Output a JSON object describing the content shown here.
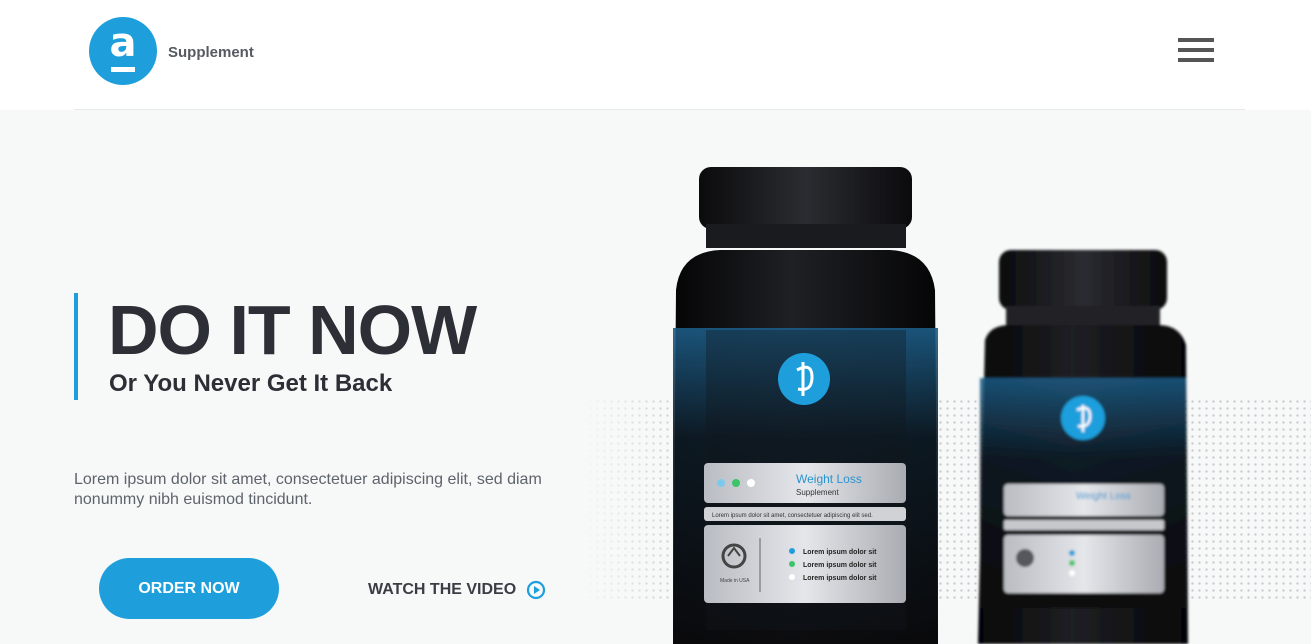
{
  "header": {
    "logo_letter": "a",
    "brand_name": "Supplement"
  },
  "hero": {
    "title": "DO IT NOW",
    "subtitle": "Or You Never Get It Back",
    "description": "Lorem ipsum dolor sit amet, consectetuer adipiscing elit, sed diam nonummy nibh euismod tincidunt.",
    "order_button": "ORDER NOW",
    "watch_link": "WATCH THE VIDEO"
  },
  "product": {
    "label_title": "Weight Loss",
    "label_subtitle": "Supplement",
    "label_line": "Lorem ipsum dolor sit amet, consectetuer adipiscing elit sed.",
    "bullets": [
      "Lorem ipsum dolor sit",
      "Lorem ipsum dolor sit",
      "Lorem ipsum dolor sit"
    ],
    "made_in": "Made in USA"
  },
  "colors": {
    "accent": "#1e9fdc",
    "dark_text": "#2d2f36"
  }
}
